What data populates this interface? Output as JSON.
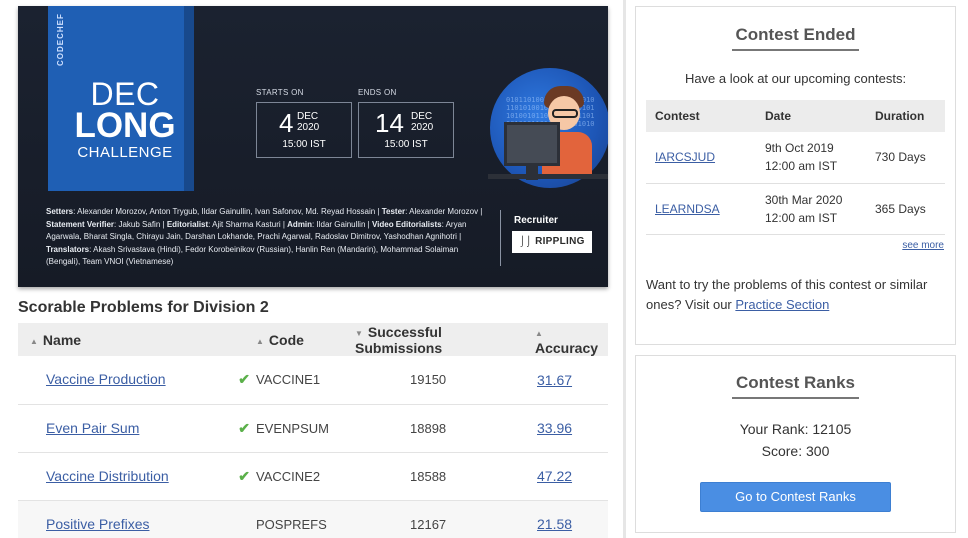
{
  "banner": {
    "brand": "CODECHEF",
    "title_line1": "DEC",
    "title_line2": "LONG",
    "title_line3": "CHALLENGE",
    "starts_label": "STARTS ON",
    "ends_label": "ENDS ON",
    "start": {
      "day": "4",
      "month": "DEC",
      "year": "2020",
      "time": "15:00 IST"
    },
    "end": {
      "day": "14",
      "month": "DEC",
      "year": "2020",
      "time": "15:00 IST"
    },
    "credits": [
      {
        "label": "Setters",
        "text": ": Alexander Morozov, Anton Trygub, Ildar Gainullin, Ivan Safonov, Md. Reyad Hossain | "
      },
      {
        "label": "Tester",
        "text": ": Alexander Morozov | "
      },
      {
        "label": "Statement Verifier",
        "text": ": Jakub Safin | "
      },
      {
        "label": "Editorialist",
        "text": ": Ajit Sharma Kasturi | "
      },
      {
        "label": "Admin",
        "text": ": Ildar Gainullin | "
      },
      {
        "label": "Video Editorialists",
        "text": ": Aryan Agarwala, Bharat Singla, Chirayu Jain, Darshan Lokhande, Prachi Agarwal, Radoslav Dimitrov, Yashodhan Agnihotri | "
      },
      {
        "label": "Translators",
        "text": ": Akash Srivastava (Hindi), Fedor Korobeinikov (Russian), Hanlin Ren (Mandarin), Mohammad Solaiman (Bengali), Team VNOI (Vietnamese)"
      }
    ],
    "recruiter_label": "Recruiter",
    "recruiter_name": "RIPPLING"
  },
  "problems": {
    "section_title": "Scorable Problems for Division 2",
    "columns": {
      "name": "Name",
      "code": "Code",
      "submissions": "Successful Submissions",
      "accuracy": "Accuracy"
    },
    "rows": [
      {
        "name": "Vaccine Production",
        "solved": true,
        "code": "VACCINE1",
        "submissions": "19150",
        "accuracy": "31.67"
      },
      {
        "name": "Even Pair Sum",
        "solved": true,
        "code": "EVENPSUM",
        "submissions": "18898",
        "accuracy": "33.96"
      },
      {
        "name": "Vaccine Distribution",
        "solved": true,
        "code": "VACCINE2",
        "submissions": "18588",
        "accuracy": "47.22"
      },
      {
        "name": "Positive Prefixes",
        "solved": false,
        "code": "POSPREFS",
        "submissions": "12167",
        "accuracy": "21.58"
      }
    ]
  },
  "contest_ended": {
    "title": "Contest Ended",
    "subtitle": "Have a look at our upcoming contests:",
    "columns": {
      "contest": "Contest",
      "date": "Date",
      "duration": "Duration"
    },
    "rows": [
      {
        "contest": "IARCSJUD",
        "date_line1": "9th Oct 2019",
        "date_line2": "12:00 am IST",
        "duration": "730 Days"
      },
      {
        "contest": "LEARNDSA",
        "date_line1": "30th Mar 2020",
        "date_line2": "12:00 am IST",
        "duration": "365 Days"
      }
    ],
    "see_more": "see more",
    "practice_prefix": "Want to try the problems of this contest or similar ones? Visit our ",
    "practice_link": "Practice Section"
  },
  "contest_ranks": {
    "title": "Contest Ranks",
    "rank_text": "Your Rank: 12105",
    "score_text": "Score: 300",
    "button_label": "Go to Contest Ranks"
  }
}
